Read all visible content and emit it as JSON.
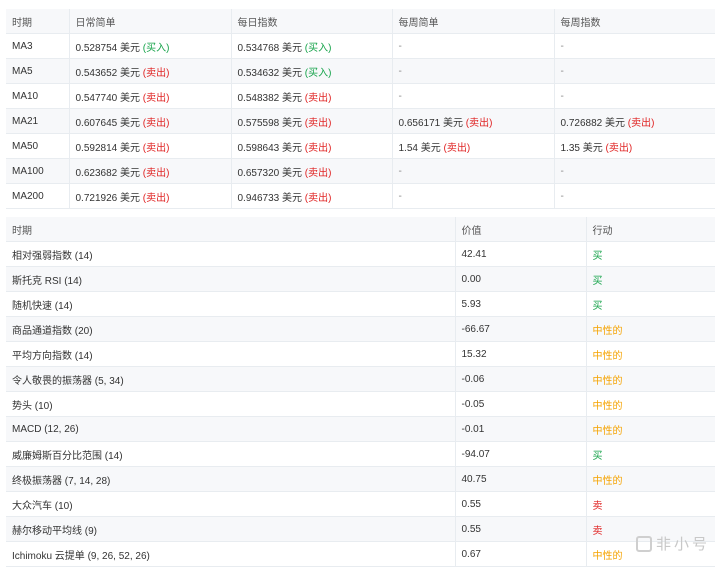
{
  "ma_table": {
    "headers": [
      "时期",
      "日常简单",
      "每日指数",
      "每周简单",
      "每周指数"
    ],
    "rows": [
      {
        "period": "MA3",
        "d_simple": "0.528754 美元",
        "d_simple_sig": "(买入)",
        "d_exp": "0.534768 美元",
        "d_exp_sig": "(买入)",
        "w_simple": "-",
        "w_simple_sig": "",
        "w_exp": "-",
        "w_exp_sig": ""
      },
      {
        "period": "MA5",
        "d_simple": "0.543652 美元",
        "d_simple_sig": "(卖出)",
        "d_exp": "0.534632 美元",
        "d_exp_sig": "(买入)",
        "w_simple": "-",
        "w_simple_sig": "",
        "w_exp": "-",
        "w_exp_sig": ""
      },
      {
        "period": "MA10",
        "d_simple": "0.547740 美元",
        "d_simple_sig": "(卖出)",
        "d_exp": "0.548382 美元",
        "d_exp_sig": "(卖出)",
        "w_simple": "-",
        "w_simple_sig": "",
        "w_exp": "-",
        "w_exp_sig": ""
      },
      {
        "period": "MA21",
        "d_simple": "0.607645 美元",
        "d_simple_sig": "(卖出)",
        "d_exp": "0.575598 美元",
        "d_exp_sig": "(卖出)",
        "w_simple": "0.656171 美元",
        "w_simple_sig": "(卖出)",
        "w_exp": "0.726882 美元",
        "w_exp_sig": "(卖出)"
      },
      {
        "period": "MA50",
        "d_simple": "0.592814 美元",
        "d_simple_sig": "(卖出)",
        "d_exp": "0.598643 美元",
        "d_exp_sig": "(卖出)",
        "w_simple": "1.54 美元",
        "w_simple_sig": "(卖出)",
        "w_exp": "1.35 美元",
        "w_exp_sig": "(卖出)"
      },
      {
        "period": "MA100",
        "d_simple": "0.623682 美元",
        "d_simple_sig": "(卖出)",
        "d_exp": "0.657320 美元",
        "d_exp_sig": "(卖出)",
        "w_simple": "-",
        "w_simple_sig": "",
        "w_exp": "-",
        "w_exp_sig": ""
      },
      {
        "period": "MA200",
        "d_simple": "0.721926 美元",
        "d_simple_sig": "(卖出)",
        "d_exp": "0.946733 美元",
        "d_exp_sig": "(卖出)",
        "w_simple": "-",
        "w_simple_sig": "",
        "w_exp": "-",
        "w_exp_sig": ""
      }
    ]
  },
  "indicator_table": {
    "headers": [
      "时期",
      "价值",
      "行动"
    ],
    "rows": [
      {
        "name": "相对强弱指数 (14)",
        "value": "42.41",
        "action": "买",
        "action_type": "buy"
      },
      {
        "name": "斯托克 RSI (14)",
        "value": "0.00",
        "action": "买",
        "action_type": "buy"
      },
      {
        "name": "随机快速 (14)",
        "value": "5.93",
        "action": "买",
        "action_type": "buy"
      },
      {
        "name": "商品通道指数 (20)",
        "value": "-66.67",
        "action": "中性的",
        "action_type": "neutral"
      },
      {
        "name": "平均方向指数 (14)",
        "value": "15.32",
        "action": "中性的",
        "action_type": "neutral"
      },
      {
        "name": "令人敬畏的振荡器 (5, 34)",
        "value": "-0.06",
        "action": "中性的",
        "action_type": "neutral"
      },
      {
        "name": "势头 (10)",
        "value": "-0.05",
        "action": "中性的",
        "action_type": "neutral"
      },
      {
        "name": "MACD (12, 26)",
        "value": "-0.01",
        "action": "中性的",
        "action_type": "neutral"
      },
      {
        "name": "威廉姆斯百分比范围 (14)",
        "value": "-94.07",
        "action": "买",
        "action_type": "buy"
      },
      {
        "name": "终极振荡器 (7, 14, 28)",
        "value": "40.75",
        "action": "中性的",
        "action_type": "neutral"
      },
      {
        "name": "大众汽车 (10)",
        "value": "0.55",
        "action": "卖",
        "action_type": "sell"
      },
      {
        "name": "赫尔移动平均线 (9)",
        "value": "0.55",
        "action": "卖",
        "action_type": "sell"
      },
      {
        "name": "Ichimoku 云提单 (9, 26, 52, 26)",
        "value": "0.67",
        "action": "中性的",
        "action_type": "neutral"
      }
    ]
  },
  "watermark": {
    "text": "非小号"
  },
  "colors": {
    "buy": "#16a34a",
    "sell": "#e02424",
    "neutral": "#f5a300"
  }
}
